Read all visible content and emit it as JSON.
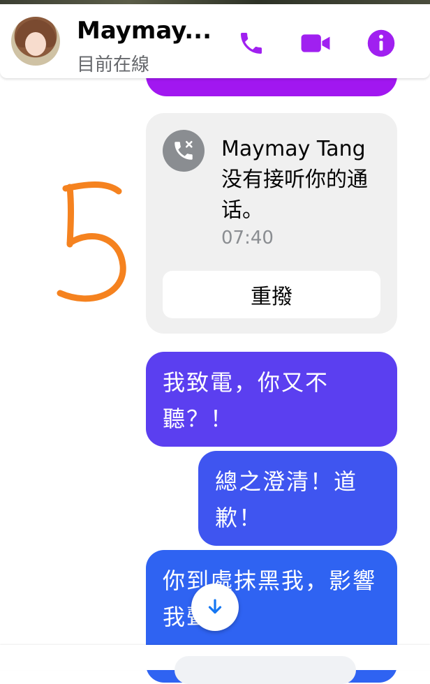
{
  "header": {
    "contact_name": "Maymay...",
    "status": "目前在線",
    "icons": [
      "phone-icon",
      "video-icon",
      "info-icon"
    ],
    "accent_color": "#a020f0"
  },
  "annotation": {
    "digit": "5",
    "color": "#f5821f"
  },
  "call_card": {
    "message": "Maymay Tang 没有接听你的通话。",
    "time": "07:40",
    "redial_label": "重撥"
  },
  "messages": [
    {
      "text": "我致電，你又不聽？！",
      "color": "#5b3ff0"
    },
    {
      "text": "總之澄清！道歉！",
      "color": "#3f55f0"
    },
    {
      "text": "你到處抹黑我，影響我聲",
      "color": "#2f63f2"
    }
  ]
}
